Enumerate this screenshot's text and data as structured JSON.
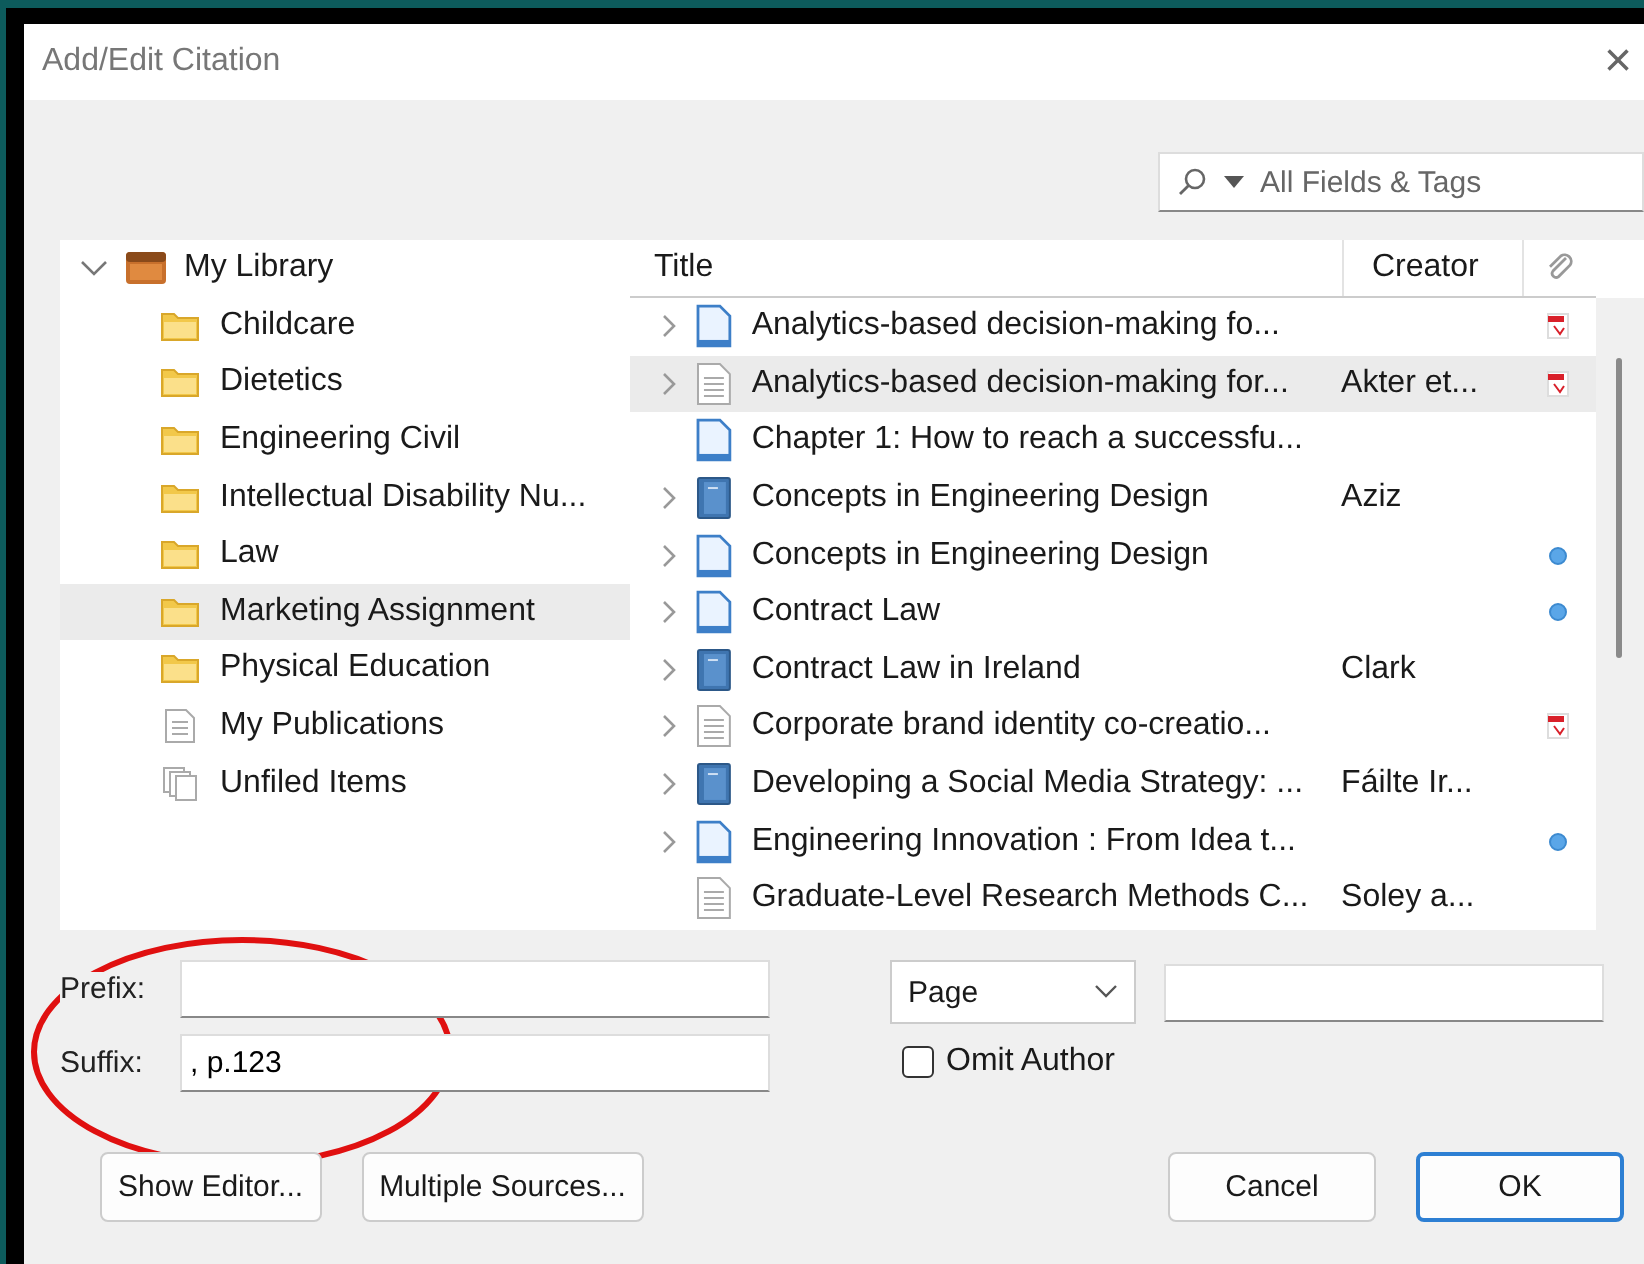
{
  "window": {
    "title": "Add/Edit Citation",
    "close": "×"
  },
  "search": {
    "mode": "All Fields & Tags"
  },
  "library": {
    "label": "My Library",
    "expanded": true,
    "children": [
      {
        "kind": "folder",
        "label": "Childcare",
        "selected": false
      },
      {
        "kind": "folder",
        "label": "Dietetics",
        "selected": false
      },
      {
        "kind": "folder",
        "label": "Engineering Civil",
        "selected": false
      },
      {
        "kind": "folder",
        "label": "Intellectual Disability Nu...",
        "selected": false
      },
      {
        "kind": "folder",
        "label": "Law",
        "selected": false
      },
      {
        "kind": "folder",
        "label": "Marketing Assignment",
        "selected": true
      },
      {
        "kind": "folder",
        "label": "Physical Education",
        "selected": false
      },
      {
        "kind": "publications",
        "label": "My Publications",
        "selected": false
      },
      {
        "kind": "unfiled",
        "label": "Unfiled Items",
        "selected": false
      }
    ]
  },
  "table": {
    "columns": [
      "Title",
      "Creator"
    ],
    "rows": [
      {
        "kind": "article",
        "expandable": true,
        "title": "Analytics-based decision-making fo...",
        "pdf_attached": true,
        "link_attached": false,
        "selected": false
      },
      {
        "kind": "document",
        "expandable": true,
        "title": "Analytics-based decision-making for...",
        "creator": "Akter et...",
        "pdf_attached": true,
        "link_attached": false,
        "selected": true
      },
      {
        "kind": "article",
        "expandable": false,
        "title": "Chapter 1: How to reach a successfu...",
        "pdf_attached": false,
        "link_attached": false,
        "selected": false
      },
      {
        "kind": "book",
        "expandable": true,
        "title": "Concepts in Engineering Design",
        "creator": "Aziz",
        "pdf_attached": false,
        "link_attached": false,
        "selected": false
      },
      {
        "kind": "article",
        "expandable": true,
        "title": "Concepts in Engineering Design",
        "pdf_attached": false,
        "link_attached": true,
        "selected": false
      },
      {
        "kind": "article",
        "expandable": true,
        "title": "Contract Law",
        "pdf_attached": false,
        "link_attached": true,
        "selected": false
      },
      {
        "kind": "book",
        "expandable": true,
        "title": "Contract Law in Ireland",
        "creator": "Clark",
        "pdf_attached": false,
        "link_attached": false,
        "selected": false
      },
      {
        "kind": "document",
        "expandable": true,
        "title": "Corporate brand identity co-creatio...",
        "pdf_attached": true,
        "link_attached": false,
        "selected": false
      },
      {
        "kind": "book",
        "expandable": true,
        "title": "Developing a Social Media Strategy: ...",
        "creator": "Fáilte Ir...",
        "pdf_attached": false,
        "link_attached": false,
        "selected": false
      },
      {
        "kind": "article",
        "expandable": true,
        "title": "Engineering Innovation : From Idea t...",
        "pdf_attached": false,
        "link_attached": true,
        "selected": false
      },
      {
        "kind": "document",
        "expandable": false,
        "title": "Graduate-Level Research Methods C...",
        "creator": "Soley a...",
        "pdf_attached": false,
        "link_attached": false,
        "selected": false
      }
    ]
  },
  "prefix": {
    "label": "Prefix:"
  },
  "suffix": {
    "label": "Suffix:",
    "value": ", p.123"
  },
  "locator": {
    "type": "Page"
  },
  "omit_author": {
    "label": "Omit Author",
    "checked": false
  },
  "buttons": [
    {
      "kind": "left",
      "label": "Show Editor..."
    },
    {
      "kind": "left",
      "label": "Multiple Sources..."
    },
    {
      "kind": "cancel",
      "label": "Cancel"
    },
    {
      "kind": "default",
      "label": "OK"
    }
  ]
}
